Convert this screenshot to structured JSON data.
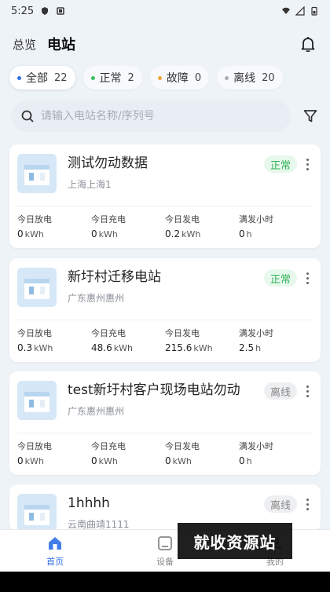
{
  "status_bar": {
    "time": "5:25"
  },
  "header": {
    "overview_label": "总览",
    "title": "电站"
  },
  "filters": [
    {
      "label": "全部",
      "count": "22",
      "dot_color": "#2f6fe4"
    },
    {
      "label": "正常",
      "count": "2",
      "dot_color": "#37c061"
    },
    {
      "label": "故障",
      "count": "0",
      "dot_color": "#f0a53a"
    },
    {
      "label": "离线",
      "count": "20",
      "dot_color": "#a8adb5"
    }
  ],
  "search": {
    "placeholder": "请输入电站名称/序列号"
  },
  "stat_labels": [
    "今日放电",
    "今日充电",
    "今日发电",
    "满发小时"
  ],
  "stations": [
    {
      "name": "测试勿动数据",
      "location": "上海上海1",
      "status": "正常",
      "status_type": "normal",
      "stats": [
        {
          "value": "0",
          "unit": "kWh"
        },
        {
          "value": "0",
          "unit": "kWh"
        },
        {
          "value": "0.2",
          "unit": "kWh"
        },
        {
          "value": "0",
          "unit": "h"
        }
      ]
    },
    {
      "name": "新圩村迁移电站",
      "location": "广东惠州惠州",
      "status": "正常",
      "status_type": "normal",
      "stats": [
        {
          "value": "0.3",
          "unit": "kWh"
        },
        {
          "value": "48.6",
          "unit": "kWh"
        },
        {
          "value": "215.6",
          "unit": "kWh"
        },
        {
          "value": "2.5",
          "unit": "h"
        }
      ]
    },
    {
      "name": "test新圩村客户现场电站勿动",
      "location": "广东惠州惠州",
      "status": "离线",
      "status_type": "offline",
      "stats": [
        {
          "value": "0",
          "unit": "kWh"
        },
        {
          "value": "0",
          "unit": "kWh"
        },
        {
          "value": "0",
          "unit": "kWh"
        },
        {
          "value": "0",
          "unit": "h"
        }
      ]
    },
    {
      "name": "1hhhh",
      "location": "云南曲靖1111",
      "status": "离线",
      "status_type": "offline",
      "stats": []
    }
  ],
  "tabbar": [
    {
      "label": "首页",
      "icon": "home-icon"
    },
    {
      "label": "设备",
      "icon": "device-icon"
    },
    {
      "label": "我的",
      "icon": "profile-icon"
    }
  ],
  "watermark": "就收资源站",
  "colors": {
    "accent": "#2f6fe4",
    "normal": "#2fb35a",
    "offline": "#888888"
  }
}
